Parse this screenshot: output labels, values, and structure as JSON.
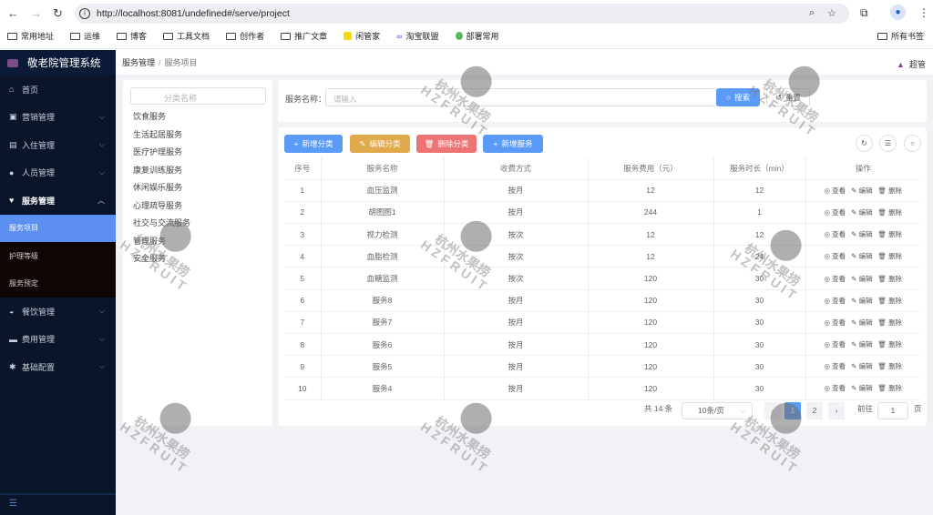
{
  "browser": {
    "url": "http://localhost:8081/undefined#/serve/project",
    "bookmarks": [
      "常用地址",
      "运维",
      "博客",
      "工具文档",
      "创作者",
      "推广文章",
      "闲管家",
      "淘宝联盟",
      "部署常用"
    ],
    "all_bookmarks": "所有书签"
  },
  "app": {
    "title": "敬老院管理系统",
    "user": "超管"
  },
  "sidebar": {
    "items": [
      {
        "label": "首页",
        "icon": "⌂"
      },
      {
        "label": "营销管理",
        "icon": "▣"
      },
      {
        "label": "入住管理",
        "icon": "▤"
      },
      {
        "label": "人员管理",
        "icon": "●"
      },
      {
        "label": "服务管理",
        "icon": "♥"
      }
    ],
    "sub": [
      "服务项目",
      "护理等级",
      "服务预定"
    ],
    "items2": [
      {
        "label": "餐饮管理",
        "icon": "◒"
      },
      {
        "label": "费用管理",
        "icon": "▬"
      },
      {
        "label": "基础配置",
        "icon": "✱"
      }
    ]
  },
  "breadcrumb": [
    "服务管理",
    "服务项目"
  ],
  "tree": {
    "placeholder": "分类名称",
    "items": [
      "饮食服务",
      "生活起居服务",
      "医疗护理服务",
      "康复训练服务",
      "休闲娱乐服务",
      "心理疏导服务",
      "社交与交流服务",
      "管理服务",
      "安全服务"
    ]
  },
  "search": {
    "label": "服务名称：",
    "placeholder": "请输入",
    "search": "搜索",
    "reset": "重置"
  },
  "toolbar": {
    "add_category": "新增分类",
    "edit_category": "编辑分类",
    "delete_category": "删除分类",
    "add_service": "新增服务"
  },
  "table": {
    "headers": [
      "序号",
      "服务名称",
      "收费方式",
      "服务费用（元）",
      "服务时长（min）",
      "操作"
    ],
    "actions": [
      "查看",
      "编辑",
      "删除"
    ],
    "rows": [
      [
        "1",
        "血压监测",
        "按月",
        "12",
        "12"
      ],
      [
        "2",
        "胡图图1",
        "按月",
        "244",
        "1"
      ],
      [
        "3",
        "视力检测",
        "按次",
        "12",
        "12"
      ],
      [
        "4",
        "血脂检测",
        "按次",
        "12",
        "24"
      ],
      [
        "5",
        "血糖监测",
        "按次",
        "120",
        "30"
      ],
      [
        "6",
        "服务8",
        "按月",
        "120",
        "30"
      ],
      [
        "7",
        "服务7",
        "按月",
        "120",
        "30"
      ],
      [
        "8",
        "服务6",
        "按月",
        "120",
        "30"
      ],
      [
        "9",
        "服务5",
        "按月",
        "120",
        "30"
      ],
      [
        "10",
        "服务4",
        "按月",
        "120",
        "30"
      ]
    ]
  },
  "pagination": {
    "total": "共 14 条",
    "page_size": "10条/页",
    "pages": [
      "1",
      "2"
    ],
    "current": "1",
    "goto": "前往",
    "goto_value": "1",
    "page_unit": "页"
  },
  "watermark": {
    "cn": "杭州水果捞",
    "en": "HZFRUIT"
  },
  "colors": {
    "primary": "#5b9bf8",
    "warning": "#e0a94b",
    "danger": "#ec7474",
    "sidebar": "#0a1529"
  }
}
